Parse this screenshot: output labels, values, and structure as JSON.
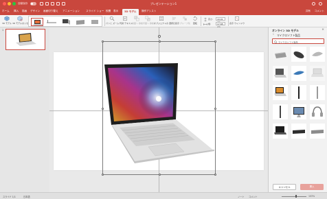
{
  "app": {
    "doc_title": "プレゼンテーション1",
    "autosave_label": "自動保存",
    "accent": "#c9473d"
  },
  "ribbon_tabs": [
    {
      "label": "ホーム",
      "active": false
    },
    {
      "label": "挿入",
      "active": false
    },
    {
      "label": "描画",
      "active": false
    },
    {
      "label": "デザイン",
      "active": false
    },
    {
      "label": "画面切り替え",
      "active": false
    },
    {
      "label": "アニメーション",
      "active": false
    },
    {
      "label": "スライド ショー",
      "active": false
    },
    {
      "label": "校閲",
      "active": false
    },
    {
      "label": "表示",
      "active": false
    },
    {
      "label": "3D モデル",
      "active": true
    },
    {
      "label": "操作アシスト",
      "active": false
    }
  ],
  "ribbon": {
    "model_3d": "3D モデル",
    "reset_model": "3D モデルのリセット",
    "pan_zoom": "パンと ズーム",
    "alt_text": "代替 テキスト",
    "bring_forward": "前面へ 移動",
    "send_backward": "背面へ 移動",
    "selection_pane": "オブジェクトの 選択と表示",
    "align": "配置",
    "group": "グループ化",
    "rotate": "回転",
    "height_label": "高さ:",
    "height_value": "10.01 cm",
    "width_label": "幅:",
    "width_value": "17.68 cm",
    "fit_window": "表示 ウィンドウ",
    "share": "共有",
    "comments": "コメント"
  },
  "thumbs": {
    "slide_number": "1"
  },
  "panel": {
    "title": "オンライン 3D モデル",
    "category": "マイクロソフト製品",
    "search_text": "マイクロソフト製品",
    "cancel": "キャンセル",
    "insert": "挿入",
    "items": [
      {
        "name": "surface-laptop-gray"
      },
      {
        "name": "surface-mouse-black"
      },
      {
        "name": "surface-arc-mouse-gray"
      },
      {
        "name": "surface-laptop-silver"
      },
      {
        "name": "surface-arc-mouse-blue"
      },
      {
        "name": "surface-laptop-open"
      },
      {
        "name": "surface-book-colorful"
      },
      {
        "name": "surface-pen-black"
      },
      {
        "name": "surface-pen-silver"
      },
      {
        "name": "surface-pen-dark"
      },
      {
        "name": "surface-studio"
      },
      {
        "name": "surface-headphones"
      },
      {
        "name": "surface-laptop-dark"
      },
      {
        "name": "surface-keyboard-black"
      },
      {
        "name": "surface-keyboard-gray"
      }
    ]
  },
  "status": {
    "slide_info": "スライド 1/1",
    "language": "日本語",
    "notes": "ノート",
    "comments": "コメント",
    "zoom": "103%"
  }
}
